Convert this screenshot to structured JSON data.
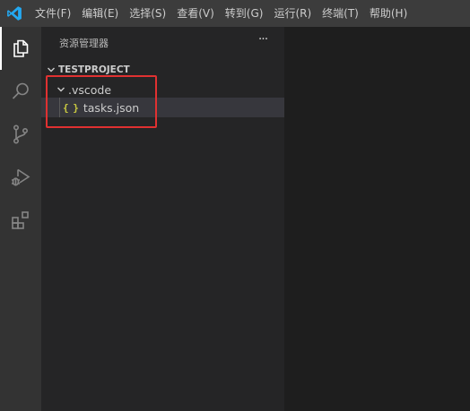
{
  "app": {
    "logo_icon": "vscode-logo-icon",
    "accent_color": "#23a9f2"
  },
  "menu": {
    "items": [
      {
        "label": "文件(F)"
      },
      {
        "label": "编辑(E)"
      },
      {
        "label": "选择(S)"
      },
      {
        "label": "查看(V)"
      },
      {
        "label": "转到(G)"
      },
      {
        "label": "运行(R)"
      },
      {
        "label": "终端(T)"
      },
      {
        "label": "帮助(H)"
      }
    ]
  },
  "activitybar": {
    "items": [
      {
        "name": "explorer",
        "icon": "files-icon",
        "active": true
      },
      {
        "name": "search",
        "icon": "search-icon",
        "active": false
      },
      {
        "name": "source-control",
        "icon": "source-control-icon",
        "active": false
      },
      {
        "name": "run-debug",
        "icon": "run-debug-icon",
        "active": false
      },
      {
        "name": "extensions",
        "icon": "extensions-icon",
        "active": false
      }
    ]
  },
  "sidebar": {
    "title": "资源管理器",
    "more_actions": "···",
    "section": {
      "title": "TESTPROJECT",
      "expanded": true
    },
    "tree": {
      "folder": {
        "label": ".vscode",
        "expanded": true
      },
      "file": {
        "label": "tasks.json",
        "icon_text": "{ }",
        "icon_color": "#cbcb41",
        "selected": true
      }
    }
  },
  "annotation": {
    "color": "#e03131"
  }
}
